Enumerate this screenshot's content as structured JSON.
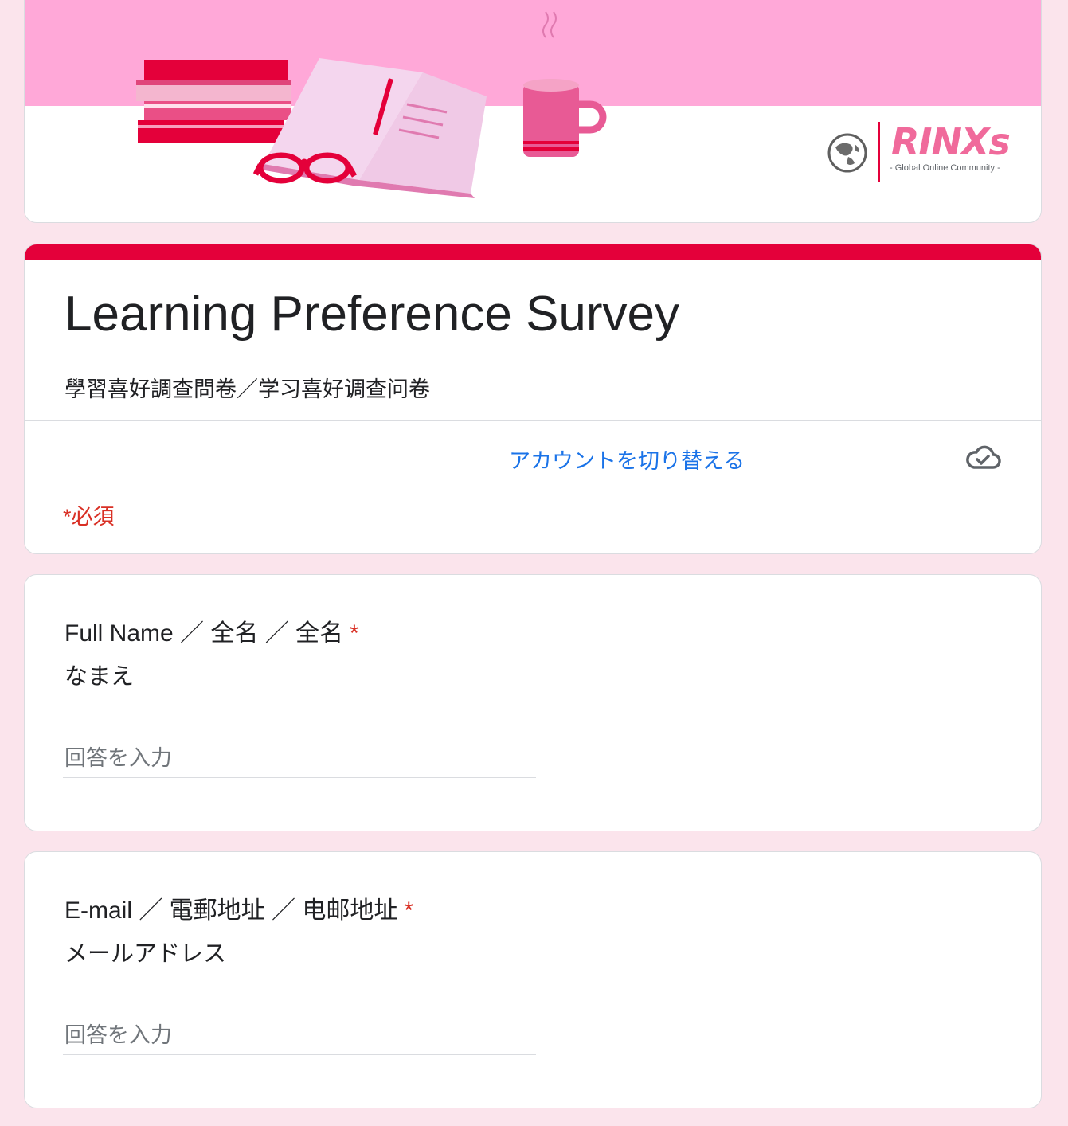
{
  "header": {
    "logo_text": "RINXs",
    "logo_tagline": "- Global Online Community -"
  },
  "form": {
    "title": "Learning Preference Survey",
    "description": "學習喜好調查問卷／学习喜好调查问卷",
    "switch_account": "アカウントを切り替える",
    "required_note": "*必須"
  },
  "questions": [
    {
      "label": "Full Name ／ 全名 ／ 全名",
      "sublabel": "なまえ",
      "required_mark": "*",
      "placeholder": "回答を入力"
    },
    {
      "label": "E-mail ／ 電郵地址 ／ 电邮地址",
      "sublabel": "メールアドレス",
      "required_mark": "*",
      "placeholder": "回答を入力"
    }
  ],
  "colors": {
    "accent": "#e4003a",
    "banner_pink": "#ffa8d8",
    "page_background": "#fbe4ec",
    "link": "#1a73e8",
    "required": "#d93025"
  },
  "icons": [
    "books-illustration",
    "glasses-illustration",
    "open-book-illustration",
    "mug-illustration",
    "globe-icon",
    "cloud-saved-icon"
  ]
}
